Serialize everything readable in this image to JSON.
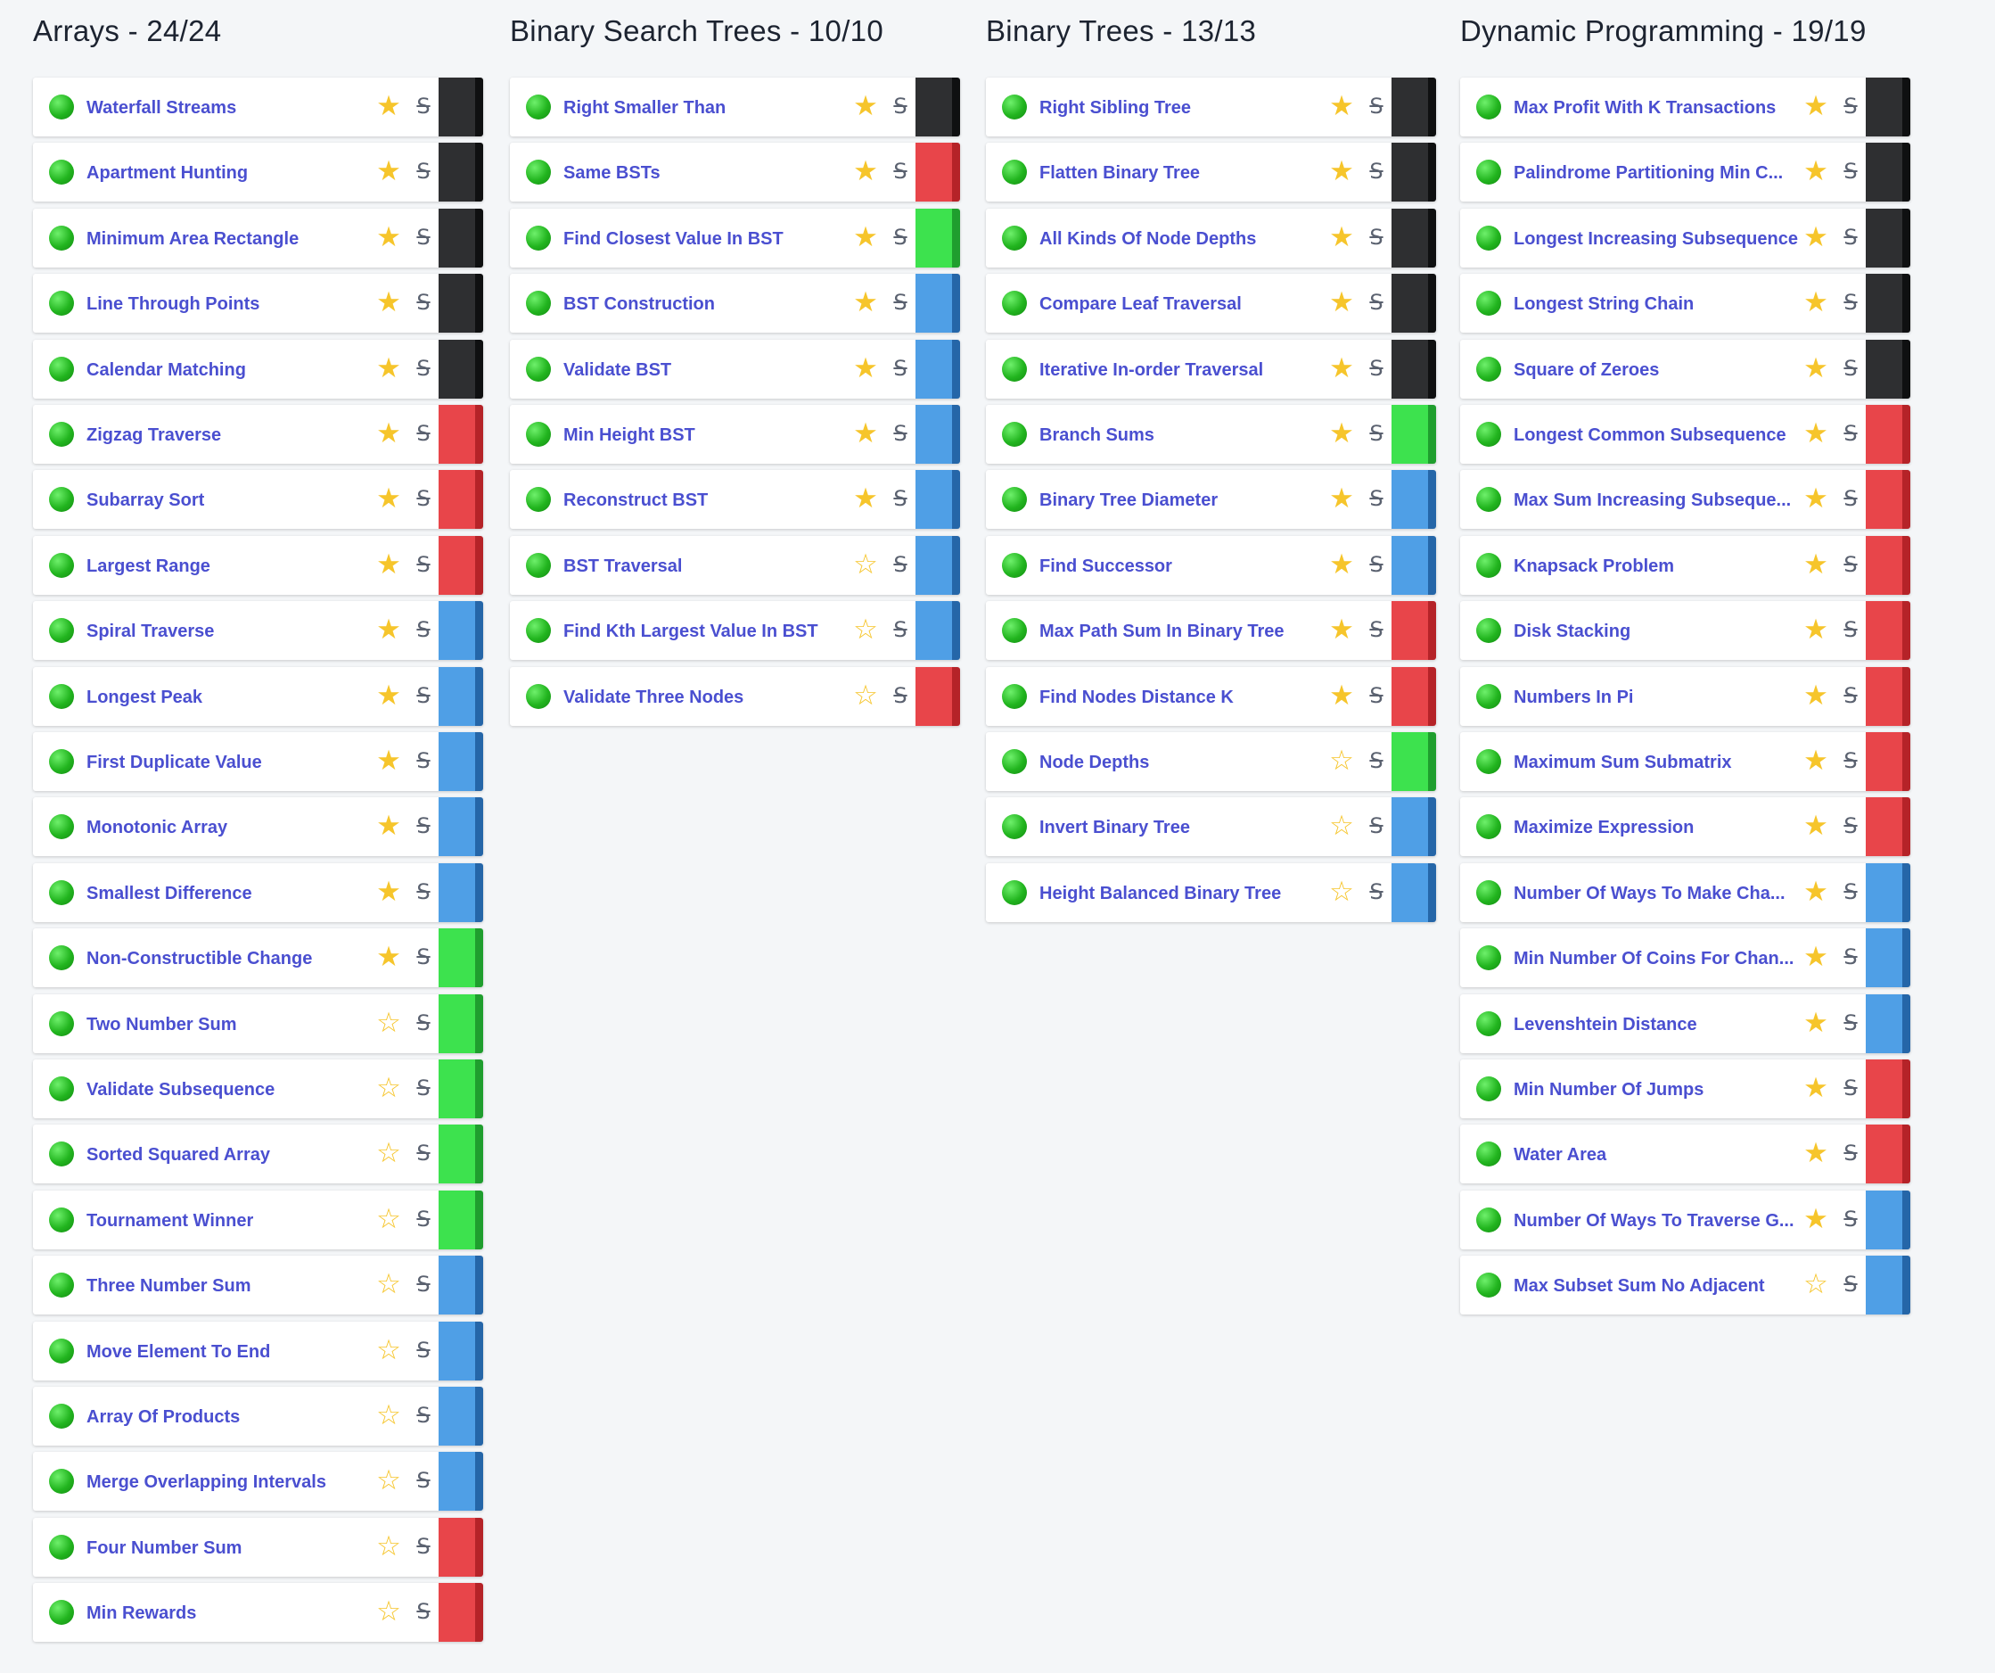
{
  "columns": [
    {
      "title": "Arrays - 24/24",
      "items": [
        {
          "name": "Waterfall Streams",
          "starred": true,
          "difficulty": "black"
        },
        {
          "name": "Apartment Hunting",
          "starred": true,
          "difficulty": "black"
        },
        {
          "name": "Minimum Area Rectangle",
          "starred": true,
          "difficulty": "black"
        },
        {
          "name": "Line Through Points",
          "starred": true,
          "difficulty": "black"
        },
        {
          "name": "Calendar Matching",
          "starred": true,
          "difficulty": "black"
        },
        {
          "name": "Zigzag Traverse",
          "starred": true,
          "difficulty": "red"
        },
        {
          "name": "Subarray Sort",
          "starred": true,
          "difficulty": "red"
        },
        {
          "name": "Largest Range",
          "starred": true,
          "difficulty": "red"
        },
        {
          "name": "Spiral Traverse",
          "starred": true,
          "difficulty": "blue"
        },
        {
          "name": "Longest Peak",
          "starred": true,
          "difficulty": "blue"
        },
        {
          "name": "First Duplicate Value",
          "starred": true,
          "difficulty": "blue"
        },
        {
          "name": "Monotonic Array",
          "starred": true,
          "difficulty": "blue"
        },
        {
          "name": "Smallest Difference",
          "starred": true,
          "difficulty": "blue"
        },
        {
          "name": "Non-Constructible Change",
          "starred": true,
          "difficulty": "green"
        },
        {
          "name": "Two Number Sum",
          "starred": false,
          "difficulty": "green"
        },
        {
          "name": "Validate Subsequence",
          "starred": false,
          "difficulty": "green"
        },
        {
          "name": "Sorted Squared Array",
          "starred": false,
          "difficulty": "green"
        },
        {
          "name": "Tournament Winner",
          "starred": false,
          "difficulty": "green"
        },
        {
          "name": "Three Number Sum",
          "starred": false,
          "difficulty": "blue"
        },
        {
          "name": "Move Element To End",
          "starred": false,
          "difficulty": "blue"
        },
        {
          "name": "Array Of Products",
          "starred": false,
          "difficulty": "blue"
        },
        {
          "name": "Merge Overlapping Intervals",
          "starred": false,
          "difficulty": "blue"
        },
        {
          "name": "Four Number Sum",
          "starred": false,
          "difficulty": "red"
        },
        {
          "name": "Min Rewards",
          "starred": false,
          "difficulty": "red"
        }
      ]
    },
    {
      "title": "Binary Search Trees - 10/10",
      "items": [
        {
          "name": "Right Smaller Than",
          "starred": true,
          "difficulty": "black"
        },
        {
          "name": "Same BSTs",
          "starred": true,
          "difficulty": "red"
        },
        {
          "name": "Find Closest Value In BST",
          "starred": true,
          "difficulty": "green"
        },
        {
          "name": "BST Construction",
          "starred": true,
          "difficulty": "blue"
        },
        {
          "name": "Validate BST",
          "starred": true,
          "difficulty": "blue"
        },
        {
          "name": "Min Height BST",
          "starred": true,
          "difficulty": "blue"
        },
        {
          "name": "Reconstruct BST",
          "starred": true,
          "difficulty": "blue"
        },
        {
          "name": "BST Traversal",
          "starred": false,
          "difficulty": "blue"
        },
        {
          "name": "Find Kth Largest Value In BST",
          "starred": false,
          "difficulty": "blue"
        },
        {
          "name": "Validate Three Nodes",
          "starred": false,
          "difficulty": "red"
        }
      ]
    },
    {
      "title": "Binary Trees - 13/13",
      "items": [
        {
          "name": "Right Sibling Tree",
          "starred": true,
          "difficulty": "black"
        },
        {
          "name": "Flatten Binary Tree",
          "starred": true,
          "difficulty": "black"
        },
        {
          "name": "All Kinds Of Node Depths",
          "starred": true,
          "difficulty": "black"
        },
        {
          "name": "Compare Leaf Traversal",
          "starred": true,
          "difficulty": "black"
        },
        {
          "name": "Iterative In-order Traversal",
          "starred": true,
          "difficulty": "black"
        },
        {
          "name": "Branch Sums",
          "starred": true,
          "difficulty": "green"
        },
        {
          "name": "Binary Tree Diameter",
          "starred": true,
          "difficulty": "blue"
        },
        {
          "name": "Find Successor",
          "starred": true,
          "difficulty": "blue"
        },
        {
          "name": "Max Path Sum In Binary Tree",
          "starred": true,
          "difficulty": "red"
        },
        {
          "name": "Find Nodes Distance K",
          "starred": true,
          "difficulty": "red"
        },
        {
          "name": "Node Depths",
          "starred": false,
          "difficulty": "green"
        },
        {
          "name": "Invert Binary Tree",
          "starred": false,
          "difficulty": "blue"
        },
        {
          "name": "Height Balanced Binary Tree",
          "starred": false,
          "difficulty": "blue"
        }
      ]
    },
    {
      "title": "Dynamic Programming - 19/19",
      "items": [
        {
          "name": "Max Profit With K Transactions",
          "starred": true,
          "difficulty": "black"
        },
        {
          "name": "Palindrome Partitioning Min C...",
          "starred": true,
          "difficulty": "black"
        },
        {
          "name": "Longest Increasing Subsequence",
          "starred": true,
          "difficulty": "black"
        },
        {
          "name": "Longest String Chain",
          "starred": true,
          "difficulty": "black"
        },
        {
          "name": "Square of Zeroes",
          "starred": true,
          "difficulty": "black"
        },
        {
          "name": "Longest Common Subsequence",
          "starred": true,
          "difficulty": "red"
        },
        {
          "name": "Max Sum Increasing Subseque...",
          "starred": true,
          "difficulty": "red"
        },
        {
          "name": "Knapsack Problem",
          "starred": true,
          "difficulty": "red"
        },
        {
          "name": "Disk Stacking",
          "starred": true,
          "difficulty": "red"
        },
        {
          "name": "Numbers In Pi",
          "starred": true,
          "difficulty": "red"
        },
        {
          "name": "Maximum Sum Submatrix",
          "starred": true,
          "difficulty": "red"
        },
        {
          "name": "Maximize Expression",
          "starred": true,
          "difficulty": "red"
        },
        {
          "name": "Number Of Ways To Make Cha...",
          "starred": true,
          "difficulty": "blue"
        },
        {
          "name": "Min Number Of Coins For Chan...",
          "starred": true,
          "difficulty": "blue"
        },
        {
          "name": "Levenshtein Distance",
          "starred": true,
          "difficulty": "blue"
        },
        {
          "name": "Min Number Of Jumps",
          "starred": true,
          "difficulty": "red"
        },
        {
          "name": "Water Area",
          "starred": true,
          "difficulty": "red"
        },
        {
          "name": "Number Of Ways To Traverse G...",
          "starred": true,
          "difficulty": "blue"
        },
        {
          "name": "Max Subset Sum No Adjacent",
          "starred": false,
          "difficulty": "blue"
        }
      ]
    }
  ],
  "icons": {
    "status": "completed-check-icon",
    "star_on": "★",
    "star_off": "☆",
    "strike": "S"
  },
  "colors": {
    "black": "#2e2f31",
    "red": "#e8454a",
    "green": "#3de24e",
    "blue": "#4f9fe6",
    "star": "#f6c52b",
    "link": "#4a4fd0"
  }
}
